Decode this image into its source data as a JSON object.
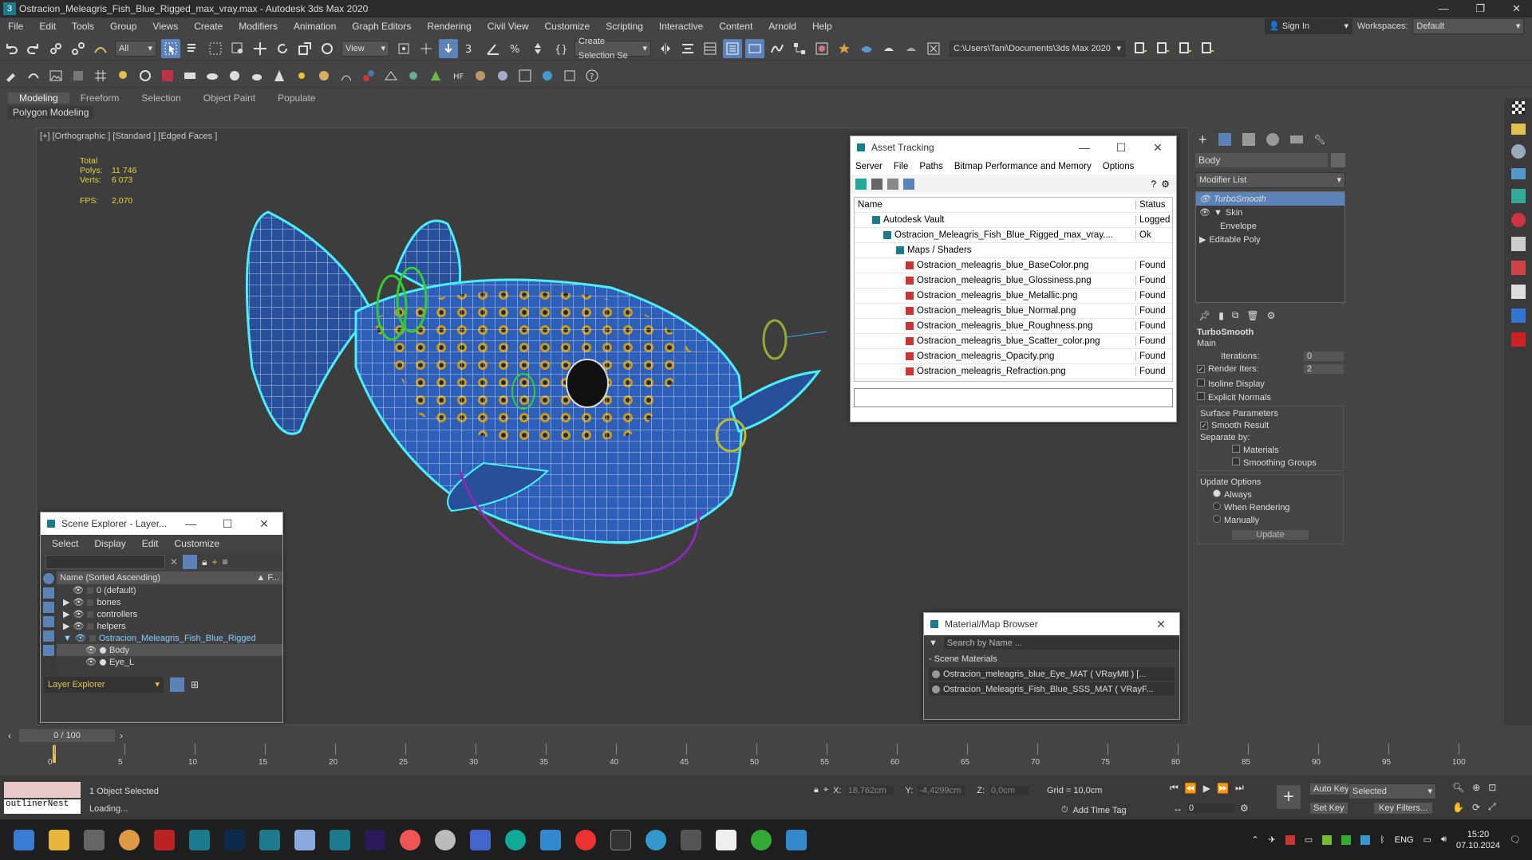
{
  "title_bar": {
    "title": "Ostracion_Meleagris_Fish_Blue_Rigged_max_vray.max - Autodesk 3ds Max 2020",
    "app_icon": "3"
  },
  "menu": [
    "File",
    "Edit",
    "Tools",
    "Group",
    "Views",
    "Create",
    "Modifiers",
    "Animation",
    "Graph Editors",
    "Rendering",
    "Civil View",
    "Customize",
    "Scripting",
    "Interactive",
    "Content",
    "Arnold",
    "Help"
  ],
  "account": {
    "sign_in": "Sign In",
    "workspaces_label": "Workspaces:",
    "workspace": "Default"
  },
  "toolbar": {
    "filter": "All",
    "view": "View",
    "selection_set": "Create Selection Se",
    "project_path": "C:\\Users\\Tani\\Documents\\3ds Max 2020"
  },
  "ribbon": {
    "tabs": [
      "Modeling",
      "Freeform",
      "Selection",
      "Object Paint",
      "Populate"
    ],
    "active": "Modeling",
    "sub": "Polygon Modeling"
  },
  "viewport": {
    "label": "[+] [Orthographic ] [Standard ] [Edged Faces ]",
    "stats": {
      "total": "Total",
      "polys_label": "Polys:",
      "polys": "11 746",
      "verts_label": "Verts:",
      "verts": "6 073",
      "fps_label": "FPS:",
      "fps": "2,070"
    }
  },
  "asset_tracking": {
    "title": "Asset Tracking",
    "menu": [
      "Server",
      "File",
      "Paths",
      "Bitmap Performance and Memory",
      "Options"
    ],
    "col_name": "Name",
    "col_status": "Status",
    "rows": [
      {
        "name": "Autodesk Vault",
        "status": "Logged"
      },
      {
        "name": "Ostracion_Meleagris_Fish_Blue_Rigged_max_vray....",
        "status": "Ok"
      },
      {
        "name": "Maps / Shaders",
        "status": ""
      },
      {
        "name": "Ostracion_meleagris_blue_BaseColor.png",
        "status": "Found"
      },
      {
        "name": "Ostracion_meleagris_blue_Glossiness.png",
        "status": "Found"
      },
      {
        "name": "Ostracion_meleagris_blue_Metallic.png",
        "status": "Found"
      },
      {
        "name": "Ostracion_meleagris_blue_Normal.png",
        "status": "Found"
      },
      {
        "name": "Ostracion_meleagris_blue_Roughness.png",
        "status": "Found"
      },
      {
        "name": "Ostracion_meleagris_blue_Scatter_color.png",
        "status": "Found"
      },
      {
        "name": "Ostracion_meleagris_Opacity.png",
        "status": "Found"
      },
      {
        "name": "Ostracion_meleagris_Refraction.png",
        "status": "Found"
      }
    ]
  },
  "scene_explorer": {
    "title": "Scene Explorer - Layer...",
    "menu": [
      "Select",
      "Display",
      "Edit",
      "Customize"
    ],
    "col_name": "Name (Sorted Ascending)",
    "col_f": "▲ F...",
    "rows": [
      {
        "name": "0 (default)"
      },
      {
        "name": "bones"
      },
      {
        "name": "controllers"
      },
      {
        "name": "helpers"
      },
      {
        "name": "Ostracion_Meleagris_Fish_Blue_Rigged"
      },
      {
        "name": "Body"
      },
      {
        "name": "Eye_L"
      }
    ],
    "footer": "Layer Explorer"
  },
  "material_browser": {
    "title": "Material/Map Browser",
    "search": "Search by Name ...",
    "section": "Scene Materials",
    "items": [
      "Ostracion_meleagris_blue_Eye_MAT ( VRayMtl ) [...",
      "Ostracion_Meleagris_Fish_Blue_SSS_MAT ( VRayF..."
    ]
  },
  "command_panel": {
    "object_name": "Body",
    "modifier_list": "Modifier List",
    "stack": [
      "TurboSmooth",
      "Skin",
      "Envelope",
      "Editable Poly"
    ],
    "turbosmooth": {
      "title": "TurboSmooth",
      "main": "Main",
      "iterations_label": "Iterations:",
      "iterations": "0",
      "render_iters_label": "Render Iters:",
      "render_iters": "2",
      "isoline": "Isoline Display",
      "explicit": "Explicit Normals",
      "surface": "Surface Parameters",
      "smooth_result": "Smooth Result",
      "separate": "Separate by:",
      "materials": "Materials",
      "smoothing": "Smoothing Groups",
      "update_options": "Update Options",
      "always": "Always",
      "when_rendering": "When Rendering",
      "manually": "Manually",
      "update": "Update"
    }
  },
  "timeline": {
    "frame": "0 / 100",
    "ticks": [
      "0",
      "5",
      "10",
      "15",
      "20",
      "25",
      "30",
      "35",
      "40",
      "45",
      "50",
      "55",
      "60",
      "65",
      "70",
      "75",
      "80",
      "85",
      "90",
      "95",
      "100"
    ]
  },
  "status": {
    "script_text": "outlinerNest",
    "selected": "1 Object Selected",
    "loading": "Loading...",
    "x_label": "X:",
    "x": "18,762cm",
    "y_label": "Y:",
    "y": "-4,4299cm",
    "z_label": "Z:",
    "z": "0,0cm",
    "grid": "Grid = 10,0cm",
    "add_time_tag": "Add Time Tag",
    "auto_key": "Auto Key",
    "set_key": "Set Key",
    "selected_dd": "Selected",
    "key_filters": "Key Filters...",
    "frame_field": "0"
  },
  "taskbar": {
    "lang": "ENG",
    "time": "15:20",
    "date": "07.10.2024"
  }
}
